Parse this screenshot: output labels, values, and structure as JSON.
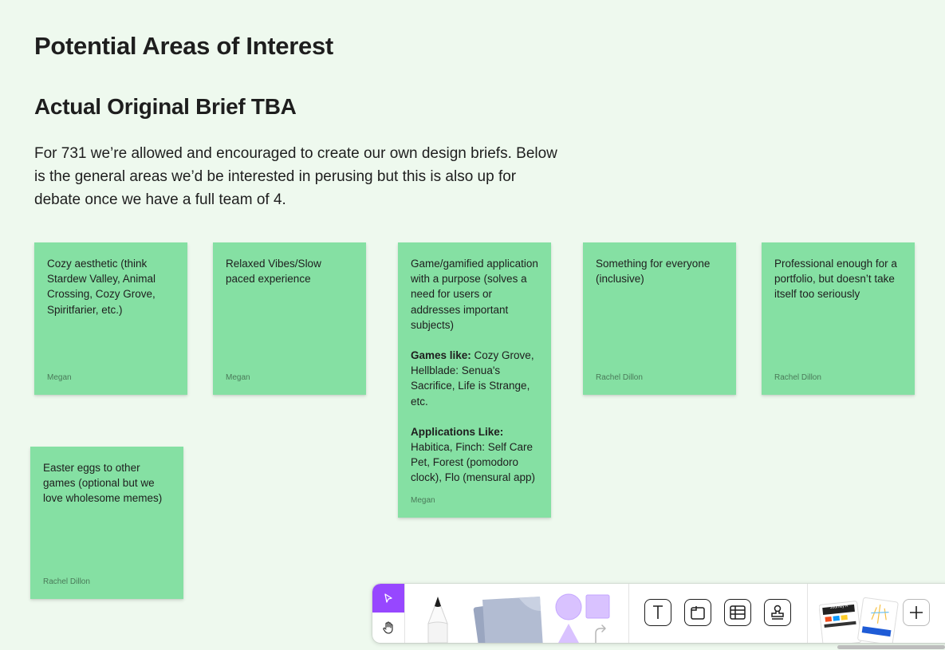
{
  "page": {
    "title": "Potential Areas of Interest",
    "subtitle": "Actual Original Brief TBA",
    "paragraph": "For 731 we’re allowed and encouraged to create our own design briefs. Below is the general areas we’d be interested in perusing but this is also up for debate once we have a full team of 4."
  },
  "stickies": [
    {
      "text": "Cozy aesthetic (think Stardew Valley, Animal Crossing, Cozy Grove, Spiritfarier, etc.)",
      "author": "Megan"
    },
    {
      "text": "Relaxed Vibes/Slow paced experience",
      "author": "Megan"
    },
    {
      "text": "Game/gamified application with a purpose (solves a need for users or addresses important subjects)",
      "games_label": "Games like:",
      "games_text": " Cozy Grove, Hellblade: Senua's Sacrifice, Life is Strange, etc.",
      "apps_label": "Applications Like:",
      "apps_text": "Habitica, Finch: Self Care Pet, Forest (pomodoro clock), Flo (mensural app)",
      "author": "Megan"
    },
    {
      "text": "Something for everyone (inclusive)",
      "author": "Rachel Dillon"
    },
    {
      "text": "Professional enough for a portfolio, but doesn’t take itself too seriously",
      "author": "Rachel Dillon"
    },
    {
      "text": "Easter eggs to other games (optional but we love wholesome memes)",
      "author": "Rachel Dillon"
    }
  ],
  "toolbar": {
    "icons": [
      "pointer-icon",
      "hand-icon",
      "pencil-icon",
      "sticky-note-icon",
      "shapes-icon",
      "connector-icon",
      "text-icon",
      "section-icon",
      "table-icon",
      "stamp-icon",
      "templates-icon",
      "plus-icon"
    ],
    "template_card_label": "Journey A",
    "colors": {
      "accent": "#9747ff",
      "sticky": "#85e0a3",
      "canvas": "#eef9ee",
      "shape": "#d9c2ff"
    }
  }
}
